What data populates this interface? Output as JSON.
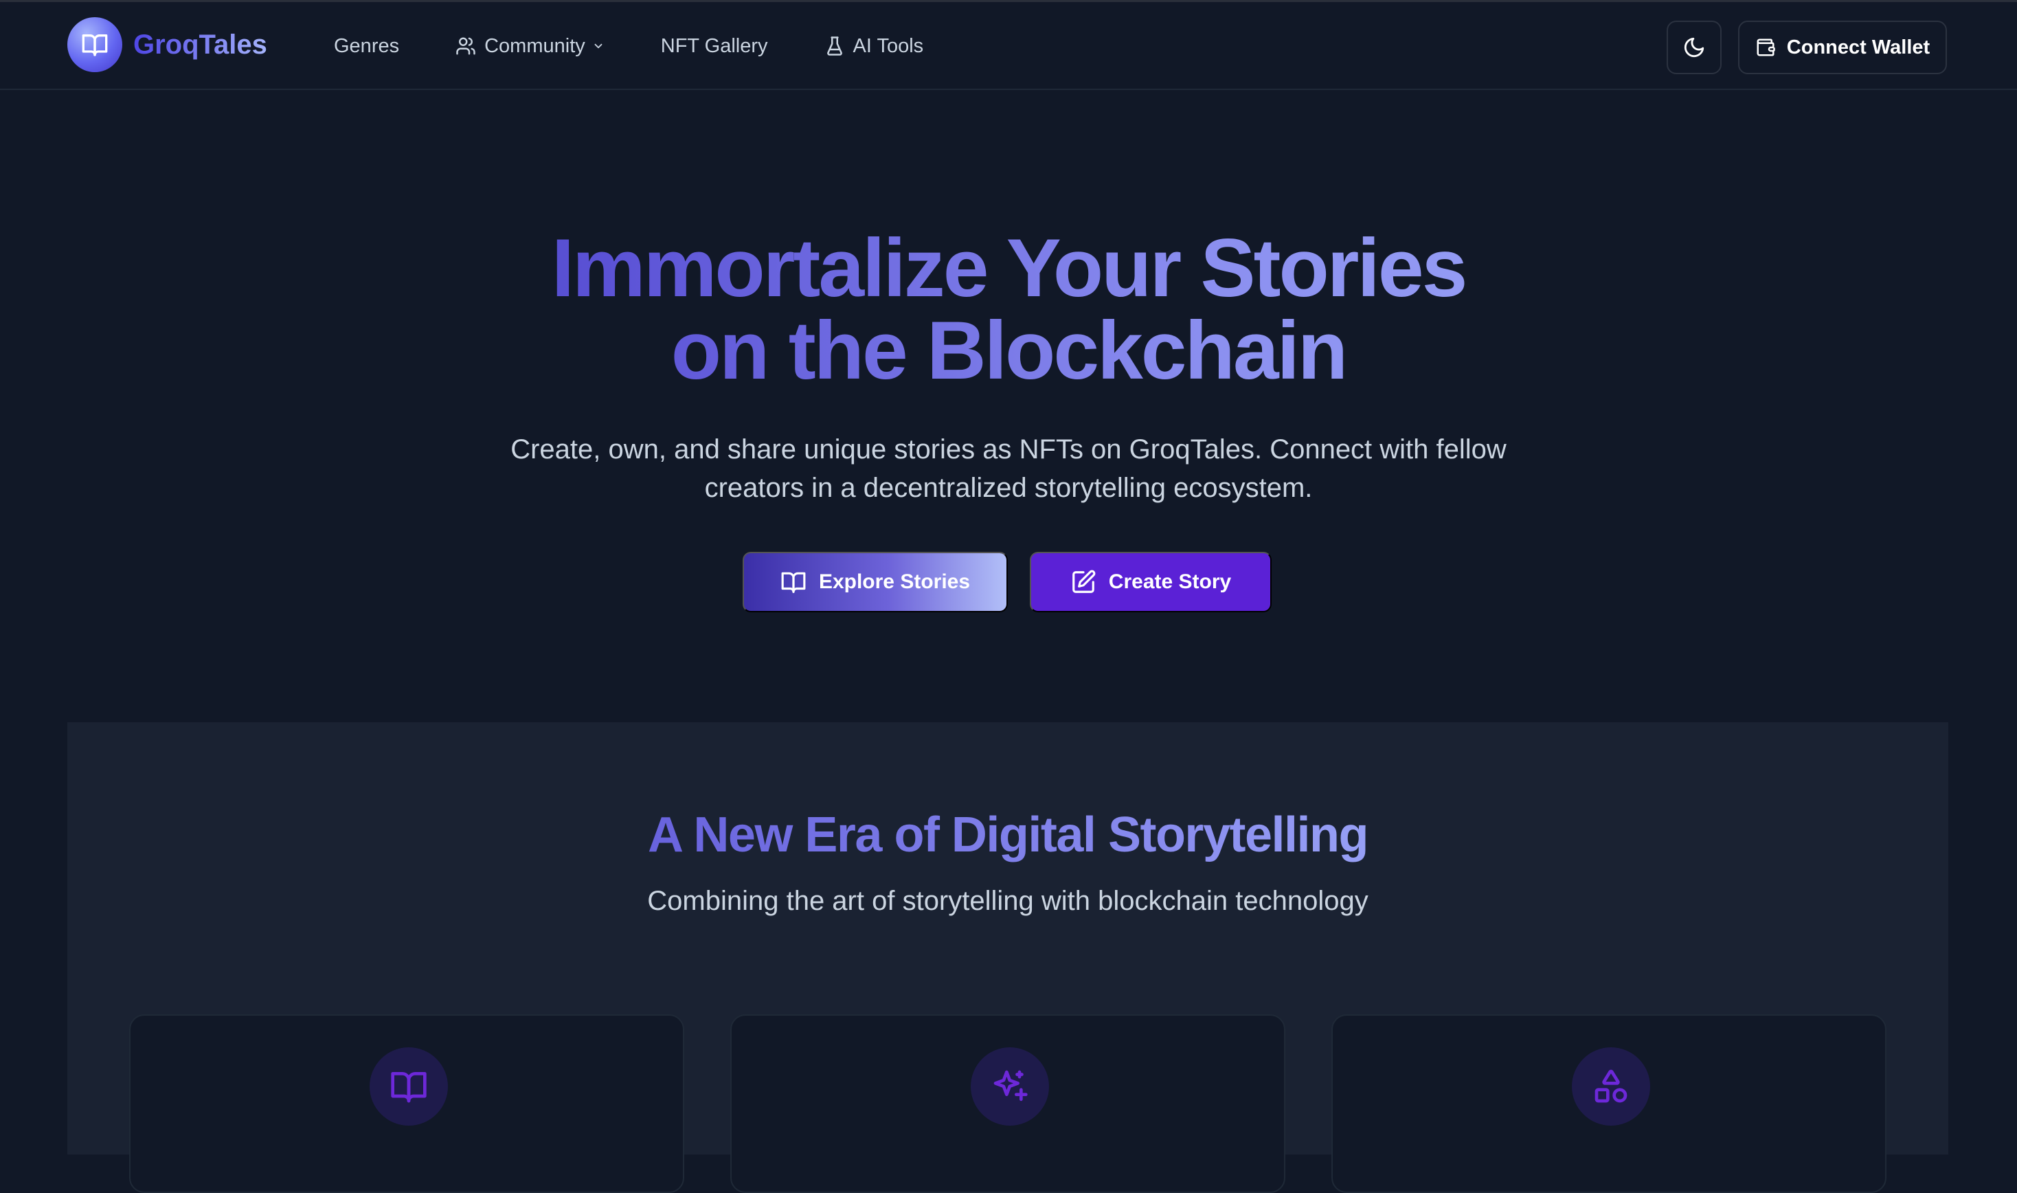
{
  "app": {
    "name": "GroqTales"
  },
  "nav": {
    "links": [
      {
        "label": "Genres"
      },
      {
        "label": "Community"
      },
      {
        "label": "NFT Gallery"
      },
      {
        "label": "AI Tools"
      }
    ],
    "connect_wallet_label": "Connect Wallet"
  },
  "hero": {
    "title_line1": "Immortalize Your Stories",
    "title_line2": "on the Blockchain",
    "subtitle": "Create, own, and share unique stories as NFTs on GroqTales. Connect with fellow creators in a decentralized storytelling ecosystem.",
    "explore_label": "Explore Stories",
    "create_label": "Create Story"
  },
  "features": {
    "title": "A New Era of Digital Storytelling",
    "subtitle": "Combining the art of storytelling with blockchain technology",
    "cards": [
      {
        "icon": "book-open-icon"
      },
      {
        "icon": "sparkles-icon"
      },
      {
        "icon": "shapes-icon"
      }
    ]
  },
  "colors": {
    "background": "#111827",
    "accent": "#5b21d6",
    "gradient_start": "#3730a3",
    "gradient_end": "#a5b4fc",
    "section_bg": "#1a2232"
  }
}
